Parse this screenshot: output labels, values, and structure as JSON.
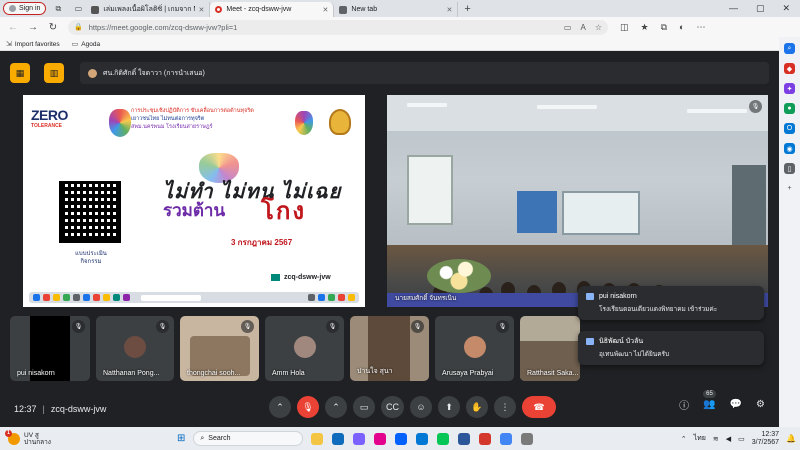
{
  "browser": {
    "signin_label": "Sign in",
    "tabs": [
      {
        "title": "เล่มเพลงเนื้อผิโลติซิ่ | เกมจาก Micr",
        "icon": "document-icon",
        "active": false
      },
      {
        "title": "Meet - zcq-dsww-jvw",
        "icon": "meet-icon",
        "active": true
      },
      {
        "title": "New tab",
        "icon": "newtab-icon",
        "active": false
      }
    ],
    "url": "https://meet.google.com/zcq-dsww-jvw?pli=1",
    "favorites": [
      "Import favorites",
      "Agoda"
    ]
  },
  "meet": {
    "presenter_name": "ศน.กิติศักดิ์ ใจดาวา (การนำเสนอ)",
    "main_left_label": "",
    "main_right_label": "นายสมศักดิ์ จันทรเนิน",
    "slide": {
      "logo": "ZERO",
      "logo_sub": "TOLERANCE",
      "headline_1": "การประชุมเชิงปฏิบัติการ ขับเคลื่อนการต่อต้านทุจริต",
      "headline_2": "เยาวชนไทย ไม่ทนต่อการทุจริต",
      "headline_3": "สพม.นครพนม โรงเรียนสายราษฎร์",
      "big_text": "ไม่ทำ ไม่ทน ไม่เฉย",
      "big_text_2": "รวมต้าน",
      "big_text_3": "โกง",
      "date": "3 กรกฎาคม 2567",
      "qr_label": "แบบประเมิน กิจกรรม",
      "meet_code": "zcq-dsww-jvw"
    },
    "tiles": [
      {
        "name": "pui nisakorn",
        "muted": true
      },
      {
        "name": "Natthanan Pong...",
        "muted": true
      },
      {
        "name": "thongchai sooh...",
        "muted": true
      },
      {
        "name": "Amm Hola",
        "muted": true
      },
      {
        "name": "ปานใจ สุนา",
        "muted": true
      },
      {
        "name": "Arusaya Prabyai",
        "muted": true
      },
      {
        "name": "Ratthasit Saka...",
        "muted": false
      }
    ],
    "chat": [
      {
        "sender": "pui nisakorn",
        "message": "โรงเรียนดอนเดียวแดงพิทยาคม เข้าร่วมค่ะ"
      },
      {
        "sender": "นิธิพัฒน์ บัวลัน",
        "message": "อุเทนพัฒนา ไม่ได้ยินครับ"
      }
    ],
    "time": "12:37",
    "meeting_code": "zcq-dsww-jvw",
    "participant_count": "65"
  },
  "taskbar": {
    "weather_badge": "1",
    "weather_temp": "UV สู",
    "weather_desc": "ปานกลาง",
    "search_placeholder": "Search",
    "lang": "ไทย",
    "clock_time": "12:37",
    "clock_date": "3/7/2567"
  },
  "colors": {
    "meet_bg": "#202124",
    "end_call": "#ea4335",
    "presenter_accent": "#f9ab00",
    "slide_red": "#c0161c",
    "slide_purple": "#6d2ba8"
  }
}
